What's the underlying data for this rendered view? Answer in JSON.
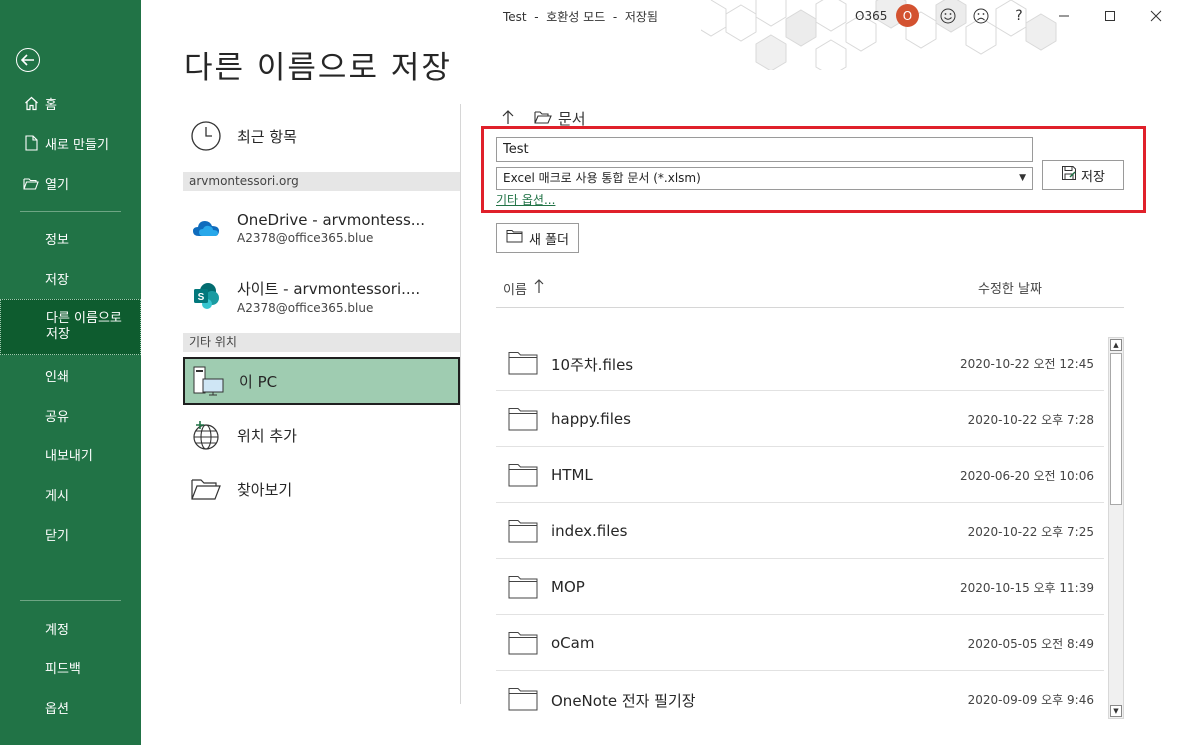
{
  "window": {
    "title": "Test  -  호환성 모드  -  저장됨",
    "account": "O365",
    "avatar_initial": "O",
    "avatar_color": "#d35230"
  },
  "nav": {
    "bg_color": "#217346",
    "home": "홈",
    "new": "새로 만들기",
    "open": "열기",
    "info": "정보",
    "save": "저장",
    "save_as_line1": "다른 이름으로",
    "save_as_line2": "저장",
    "print": "인쇄",
    "share": "공유",
    "export": "내보내기",
    "publish": "게시",
    "close": "닫기",
    "account": "계정",
    "feedback": "피드백",
    "options": "옵션"
  },
  "page": {
    "heading": "다른 이름으로 저장"
  },
  "places": {
    "recent": "최근 항목",
    "group_org": "arvmontessori.org",
    "onedrive_name": "OneDrive - arvmontess...",
    "onedrive_sub": "A2378@office365.blue",
    "sites_name": "사이트 - arvmontessori....",
    "sites_sub": "A2378@office365.blue",
    "group_other": "기타 위치",
    "this_pc": "이 PC",
    "add_place": "위치 추가",
    "browse": "찾아보기"
  },
  "save_panel": {
    "breadcrumb": "문서",
    "filename": "Test",
    "filetype": "Excel 매크로 사용 통합 문서 (*.xlsm)",
    "more_options": "기타 옵션...",
    "save_button": "저장",
    "new_folder": "새 폴더",
    "col_name": "이름",
    "col_date": "수정한 날짜",
    "highlight_color": "#e0202a"
  },
  "files": [
    {
      "name": "10주차.files",
      "date": "2020-10-22 오전 12:45"
    },
    {
      "name": "happy.files",
      "date": "2020-10-22 오후 7:28"
    },
    {
      "name": "HTML",
      "date": "2020-06-20 오전 10:06"
    },
    {
      "name": "index.files",
      "date": "2020-10-22 오후 7:25"
    },
    {
      "name": "MOP",
      "date": "2020-10-15 오후 11:39"
    },
    {
      "name": "oCam",
      "date": "2020-05-05 오전 8:49"
    },
    {
      "name": "OneNote 전자 필기장",
      "date": "2020-09-09 오후 9:46"
    }
  ]
}
